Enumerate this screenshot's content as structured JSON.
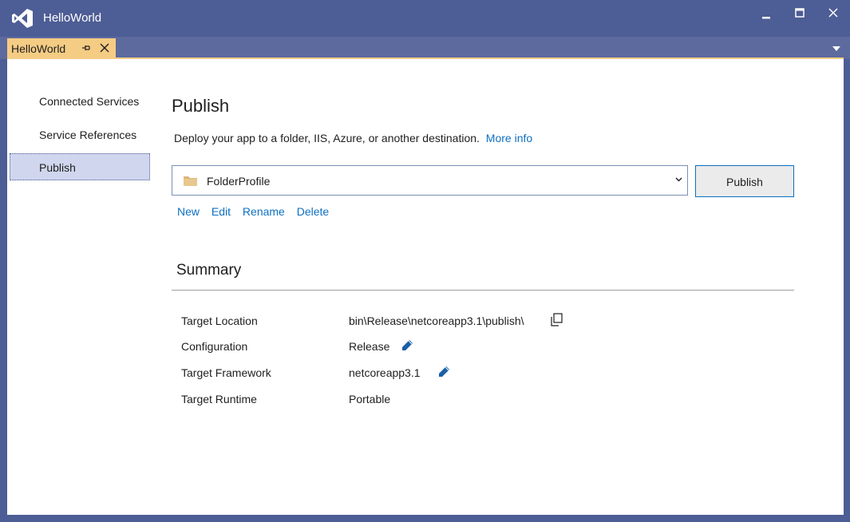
{
  "window": {
    "title": "HelloWorld",
    "logo_icon": "visual-studio-logo-icon"
  },
  "tab": {
    "label": "HelloWorld",
    "pin_icon": "pin-icon",
    "close_icon": "close-icon"
  },
  "sidebar": {
    "items": [
      {
        "label": "Connected Services",
        "selected": false
      },
      {
        "label": "Service References",
        "selected": false
      },
      {
        "label": "Publish",
        "selected": true
      }
    ]
  },
  "main": {
    "title": "Publish",
    "description": "Deploy your app to a folder, IIS, Azure, or another destination.",
    "more_info": "More info",
    "profile": {
      "selected": "FolderProfile",
      "icon": "folder-icon"
    },
    "publish_button": "Publish",
    "actions": [
      "New",
      "Edit",
      "Rename",
      "Delete"
    ]
  },
  "summary": {
    "title": "Summary",
    "rows": [
      {
        "key": "Target Location",
        "value": "bin\\Release\\netcoreapp3.1\\publish\\",
        "icon": "copy-icon"
      },
      {
        "key": "Configuration",
        "value": "Release",
        "icon": "edit-pencil-icon"
      },
      {
        "key": "Target Framework",
        "value": "netcoreapp3.1",
        "icon": "edit-pencil-icon"
      },
      {
        "key": "Target Runtime",
        "value": "Portable",
        "icon": ""
      }
    ]
  },
  "colors": {
    "title_bar": "#4d5d95",
    "active_tab": "#f5cc84",
    "link": "#0e70c0",
    "selected_nav": "#cfd6ee"
  }
}
